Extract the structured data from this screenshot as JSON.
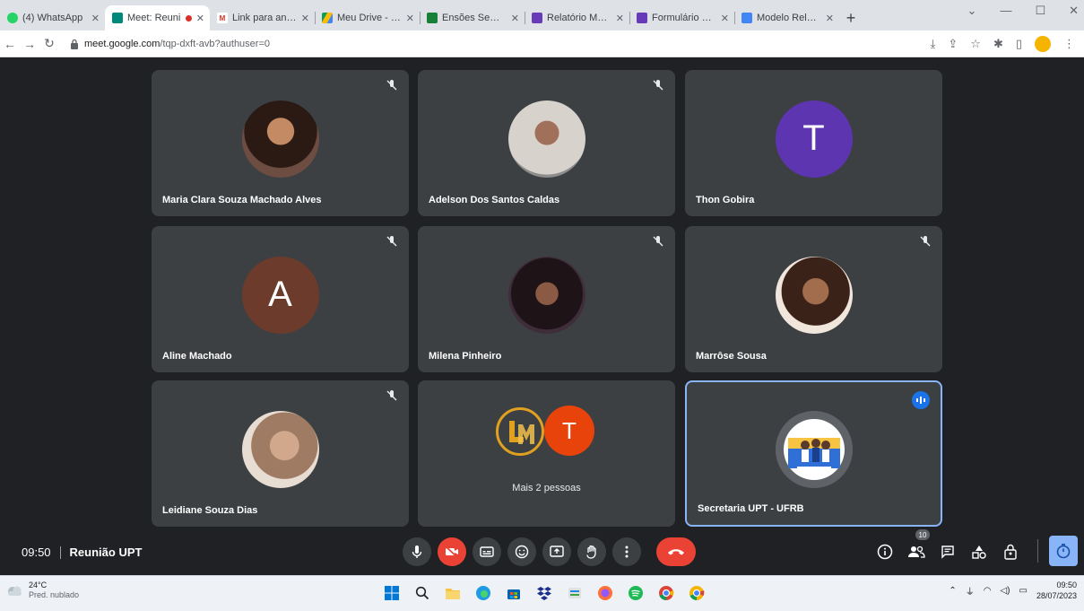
{
  "browser": {
    "tabs": [
      {
        "title": "(4) WhatsApp",
        "favicon": "whatsapp-icon",
        "color": "#25d366",
        "active": false,
        "recording": false
      },
      {
        "title": "Meet: Reuni",
        "favicon": "meet-icon",
        "color": "#00897b",
        "active": true,
        "recording": true
      },
      {
        "title": "Link para anexo",
        "favicon": "gmail-icon",
        "color": "#d93025",
        "active": false,
        "recording": false
      },
      {
        "title": "Meu Drive - Goo",
        "favicon": "drive-icon",
        "color": "#fbbc04",
        "active": false,
        "recording": false
      },
      {
        "title": "Ensões Semana",
        "favicon": "sheets-icon",
        "color": "#188038",
        "active": false,
        "recording": false
      },
      {
        "title": "Relatório Mensal",
        "favicon": "forms-icon",
        "color": "#673ab7",
        "active": false,
        "recording": false
      },
      {
        "title": "Formulário de En",
        "favicon": "forms-icon",
        "color": "#673ab7",
        "active": false,
        "recording": false
      },
      {
        "title": "Modelo Relatóri",
        "favicon": "docs-icon",
        "color": "#4285f4",
        "active": false,
        "recording": false
      }
    ],
    "new_tab": "+",
    "url_host": "meet.google.com",
    "url_path": "/tqp-dxft-avb?authuser=0"
  },
  "meeting": {
    "time": "09:50",
    "title": "Reunião UPT",
    "participants_badge": "10",
    "more_people_label": "Mais 2 pessoas",
    "more_people_letter": "T",
    "tiles": [
      {
        "name": "Maria Clara Souza Machado Alves",
        "type": "photo",
        "color": "#6d4c41",
        "muted": true
      },
      {
        "name": "Adelson Dos Santos Caldas",
        "type": "photo",
        "color": "#8d8d8d",
        "muted": true
      },
      {
        "name": "Thon Gobira",
        "type": "letter",
        "letter": "T",
        "color": "#5e35b1",
        "muted": false
      },
      {
        "name": "Aline Machado",
        "type": "letter",
        "letter": "A",
        "color": "#6d3b2b",
        "muted": true
      },
      {
        "name": "Milena Pinheiro",
        "type": "photo",
        "color": "#3f2d3a",
        "muted": true
      },
      {
        "name": "Marrôse Sousa",
        "type": "photo",
        "color": "#7b4a32",
        "muted": true
      },
      {
        "name": "Leidiane Souza Dias",
        "type": "photo",
        "color": "#9e7b62",
        "muted": true
      },
      {
        "name": "Secretaria UPT - UFRB",
        "type": "logo",
        "color": "#5f6368",
        "muted": false,
        "speaking": true
      }
    ]
  },
  "taskbar": {
    "temperature": "24°C",
    "weather": "Pred. nublado",
    "time": "09:50",
    "date": "28/07/2023"
  },
  "colors": {
    "meet_bg": "#202124",
    "tile_bg": "#3c4043",
    "leave_red": "#ea4335",
    "accent_blue": "#8ab4f8"
  }
}
